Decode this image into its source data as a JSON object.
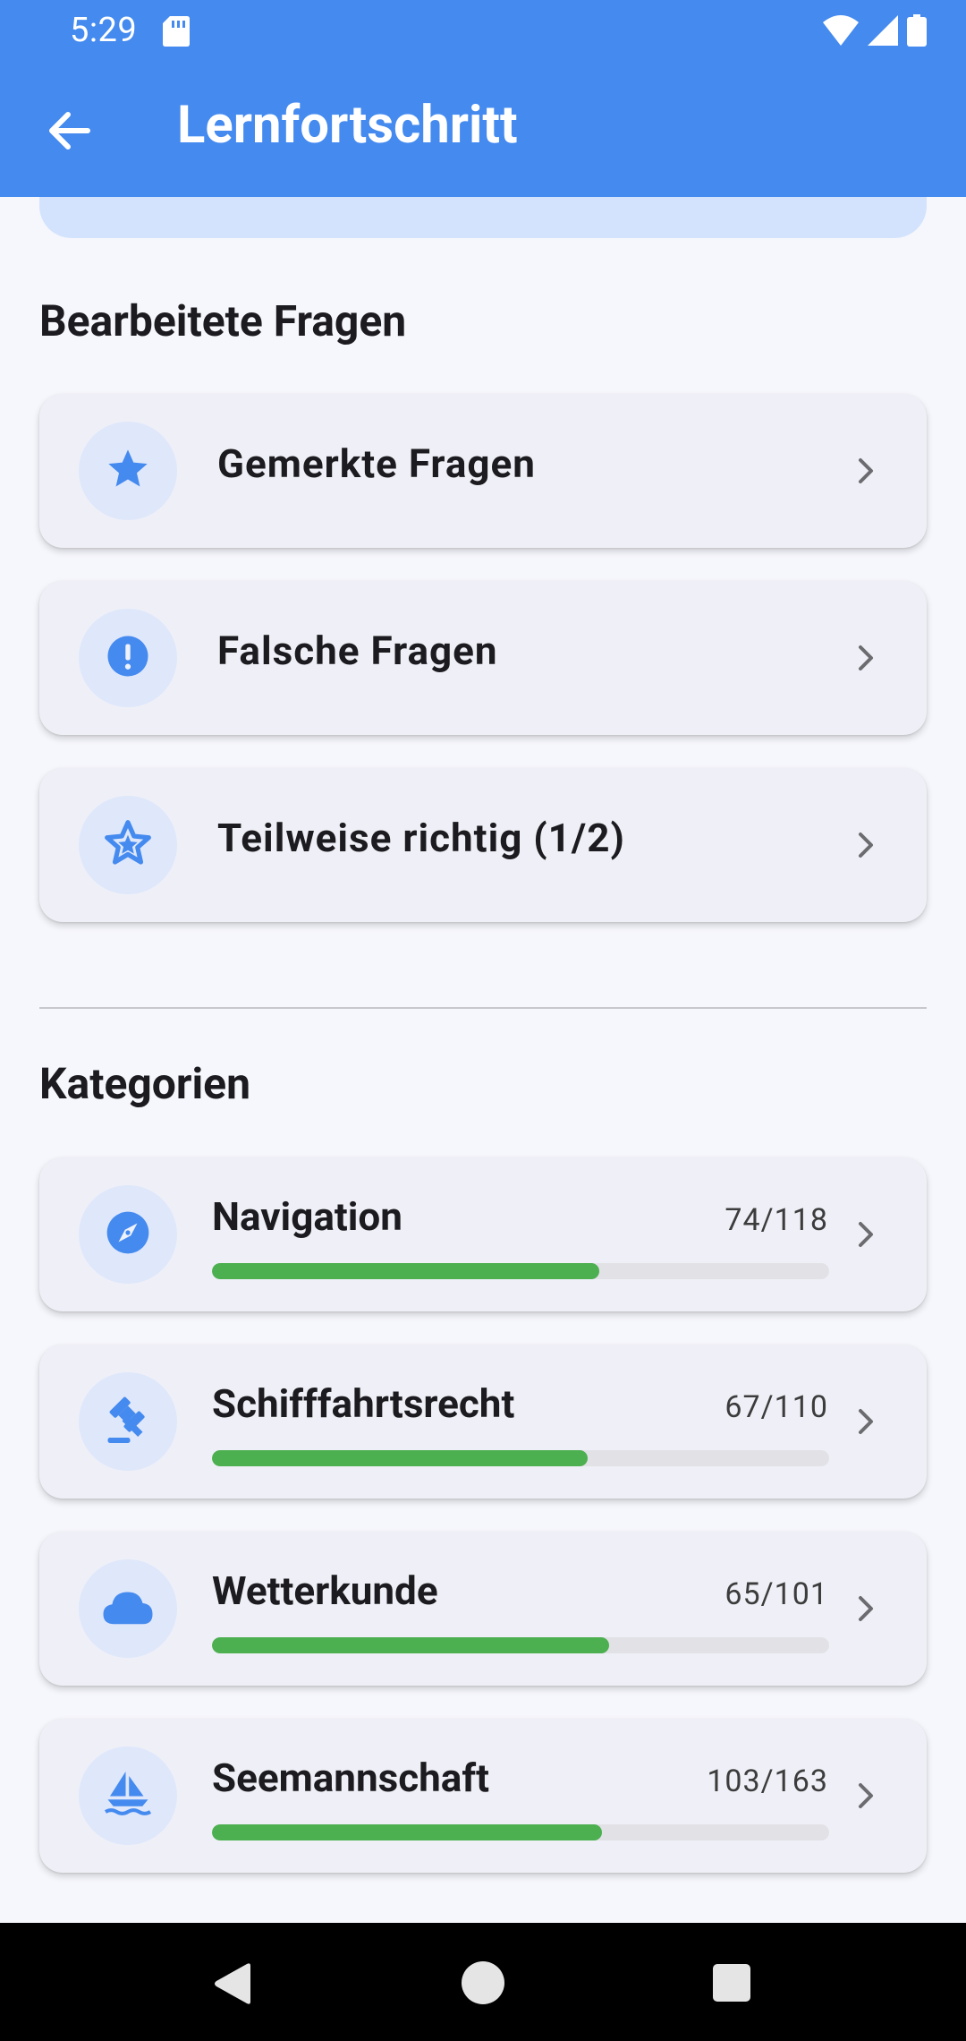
{
  "status_bar": {
    "time": "5:29"
  },
  "app_bar": {
    "title": "Lernfortschritt"
  },
  "sections": {
    "edited_title": "Bearbeitete Fragen",
    "categories_title": "Kategorien"
  },
  "edited_items": [
    {
      "label": "Gemerkte Fragen",
      "icon": "star-icon"
    },
    {
      "label": "Falsche Fragen",
      "icon": "alert-circle-icon"
    },
    {
      "label": "Teilweise richtig (1/2)",
      "icon": "star-half-icon"
    }
  ],
  "categories": [
    {
      "name": "Navigation",
      "count": "74/118",
      "progress": 0.627,
      "icon": "compass-icon"
    },
    {
      "name": "Schifffahrtsrecht",
      "count": "67/110",
      "progress": 0.609,
      "icon": "gavel-icon"
    },
    {
      "name": "Wetterkunde",
      "count": "65/101",
      "progress": 0.644,
      "icon": "cloud-icon"
    },
    {
      "name": "Seemannschaft",
      "count": "103/163",
      "progress": 0.632,
      "icon": "sailboat-icon"
    }
  ],
  "colors": {
    "primary": "#448aef",
    "icon_blue": "#448aef",
    "progress_green": "#4caf50"
  }
}
